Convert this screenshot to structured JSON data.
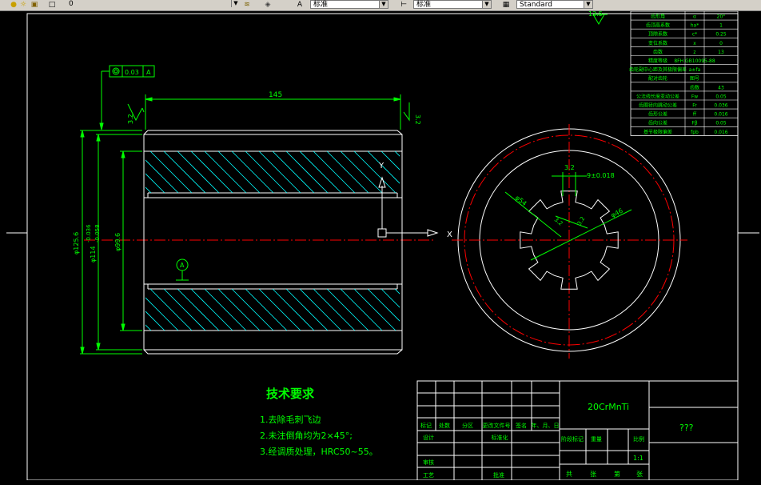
{
  "toolbar": {
    "layer_value": "0",
    "text_style": "标准",
    "dim_style": "标准",
    "table_style": "Standard",
    "icons": [
      "lightbulb-icon",
      "sun-icon",
      "lock-icon",
      "color-swatch-icon",
      "layer-stack-icon",
      "layers-icon",
      "text-style-icon",
      "dim-style-icon",
      "table-style-icon"
    ]
  },
  "drawing": {
    "colors": {
      "line": "#ffffff",
      "dim": "#00ff00",
      "center": "#ff0000",
      "hatch": "#00ffff",
      "title": "#00ff00"
    },
    "section_view": {
      "length_dim": "145",
      "dia_outer": "φ125.6",
      "dia_pitch": "φ114 -0.036 -0.058",
      "dia_pitch_main": "φ114",
      "dia_pitch_upper": "-0.036",
      "dia_pitch_lower": "-0.058",
      "dia_inner": "φ99.6",
      "runout_value": "0.03",
      "datum": "A",
      "roughness_left": "3.2",
      "roughness_right": "3.2",
      "datum_bubble": "A",
      "axis_x": "X",
      "axis_y": "Y"
    },
    "end_view": {
      "key_width": "9±0.018",
      "roughness_top": "3.2",
      "dia_54": "φ54",
      "dia_46": "φ46",
      "r_small": "3.2",
      "r_small2": "3.2"
    },
    "top_roughness": "12.5",
    "tech_req": {
      "title": "技术要求",
      "items": [
        "1.去除毛刺飞边",
        "2.未注倒角均为2×45°;",
        "3.经调质处理，HRC50~55。"
      ]
    },
    "param_table": {
      "rows": [
        [
          "齿形角",
          "α",
          "20°"
        ],
        [
          "齿顶高系数",
          "ha*",
          "1"
        ],
        [
          "顶隙系数",
          "c*",
          "0.25"
        ],
        [
          "变位系数",
          "x",
          "0"
        ],
        [
          "齿数",
          "z",
          "13"
        ],
        [
          "精度等级",
          "8FH GB10095-88",
          ""
        ],
        [
          "齿轮副中心距及其极限偏差",
          "a±fa",
          ""
        ],
        [
          "配对齿轮",
          "图号",
          ""
        ],
        [
          "",
          "齿数",
          "43"
        ],
        [
          "公法线长度变动公差",
          "Fw",
          "0.05"
        ],
        [
          "齿圈径向跳动公差",
          "Fr",
          "0.036"
        ],
        [
          "齿形公差",
          "ff",
          "0.016"
        ],
        [
          "齿向公差",
          "Fβ",
          "0.05"
        ],
        [
          "基节极限偏差",
          "fpb",
          "0.016"
        ]
      ]
    },
    "title_block": {
      "material": "20CrMnTi",
      "name": "???",
      "headers": [
        "标记",
        "处数",
        "分区",
        "更改文件号",
        "签名",
        "年、月、日"
      ],
      "labels": [
        "设计",
        "标准化",
        "审核",
        "工艺",
        "批准",
        "阶段标记",
        "重量",
        "比例"
      ],
      "scale": "1:1",
      "sheet": [
        "共",
        "张",
        "第",
        "张"
      ]
    }
  }
}
